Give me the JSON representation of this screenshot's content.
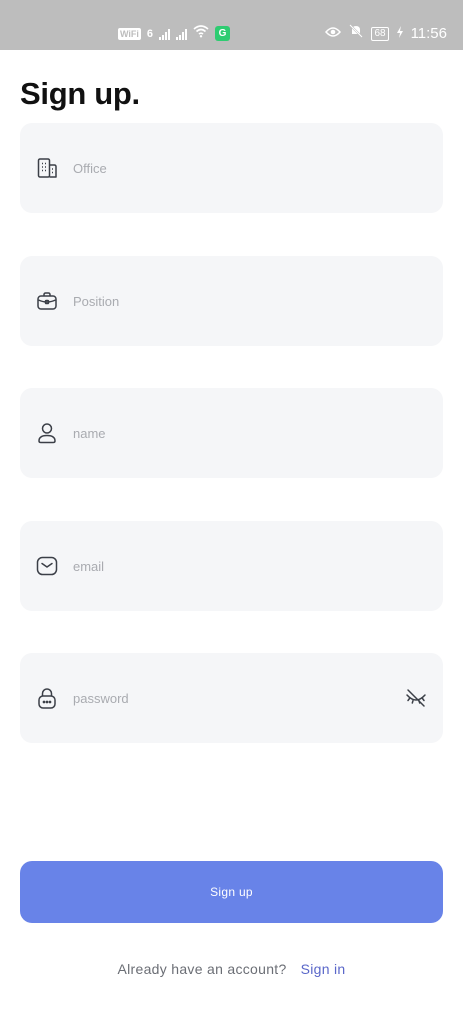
{
  "status_bar": {
    "wifi_tag": "WiFi",
    "network_num": "6",
    "app_badge": "G",
    "battery": "68",
    "time": "11:56",
    "icons": [
      "wifi-tag-icon",
      "signal-icon",
      "signal-icon",
      "wifi-icon",
      "app-badge-icon",
      "eye-icon",
      "bell-off-icon",
      "battery-icon",
      "charging-icon"
    ]
  },
  "page_title": "Sign up.",
  "fields": {
    "office": {
      "placeholder": "Office",
      "value": "",
      "icon": "building-icon"
    },
    "position": {
      "placeholder": "Position",
      "value": "",
      "icon": "briefcase-icon"
    },
    "name": {
      "placeholder": "name",
      "value": "",
      "icon": "user-icon"
    },
    "email": {
      "placeholder": "email",
      "value": "",
      "icon": "mail-icon"
    },
    "password": {
      "placeholder": "password",
      "value": "",
      "icon": "lock-icon",
      "toggle_icon": "eye-off-icon"
    }
  },
  "signup_button": "Sign up",
  "footer": {
    "prompt": "Already have an account?",
    "link": "Sign in"
  },
  "colors": {
    "accent": "#6883e8",
    "link": "#5a67c9",
    "field_bg": "#f5f6f8",
    "status_bar": "#bdbdbd"
  }
}
